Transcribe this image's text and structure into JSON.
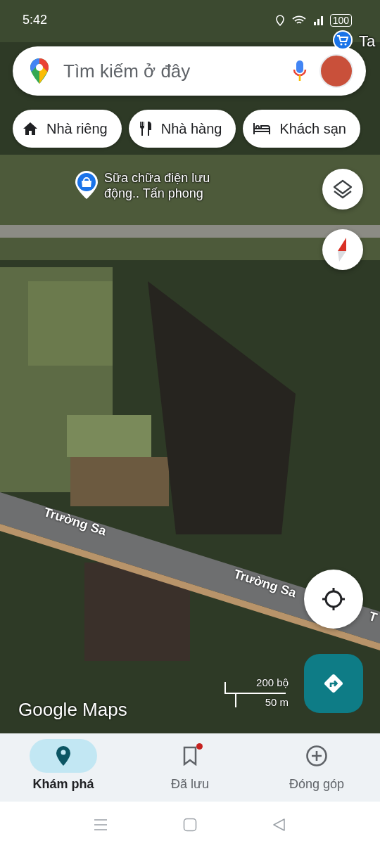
{
  "status_bar": {
    "time": "5:42",
    "battery": "100"
  },
  "search": {
    "placeholder": "Tìm kiếm ở đây"
  },
  "chips": [
    {
      "kind": "home",
      "label": "Nhà riêng"
    },
    {
      "kind": "restaurant",
      "label": "Nhà hàng"
    },
    {
      "kind": "hotel",
      "label": "Khách sạn"
    }
  ],
  "map": {
    "places": [
      {
        "kind": "shop",
        "label": "Sữa chữa điện lưu động.. Tấn phong"
      },
      {
        "kind": "cart",
        "label": "Ta"
      }
    ],
    "roads": [
      {
        "label": "Trường Sa"
      },
      {
        "label": "Trường Sa"
      },
      {
        "label": "T"
      }
    ],
    "scale": {
      "imperial": "200 bộ",
      "metric": "50 m"
    },
    "logo": "Google Maps"
  },
  "bottom_nav": [
    {
      "kind": "explore",
      "label": "Khám phá",
      "selected": true,
      "badge": false
    },
    {
      "kind": "saved",
      "label": "Đã lưu",
      "selected": false,
      "badge": true
    },
    {
      "kind": "contribute",
      "label": "Đóng góp",
      "selected": false,
      "badge": false
    }
  ]
}
